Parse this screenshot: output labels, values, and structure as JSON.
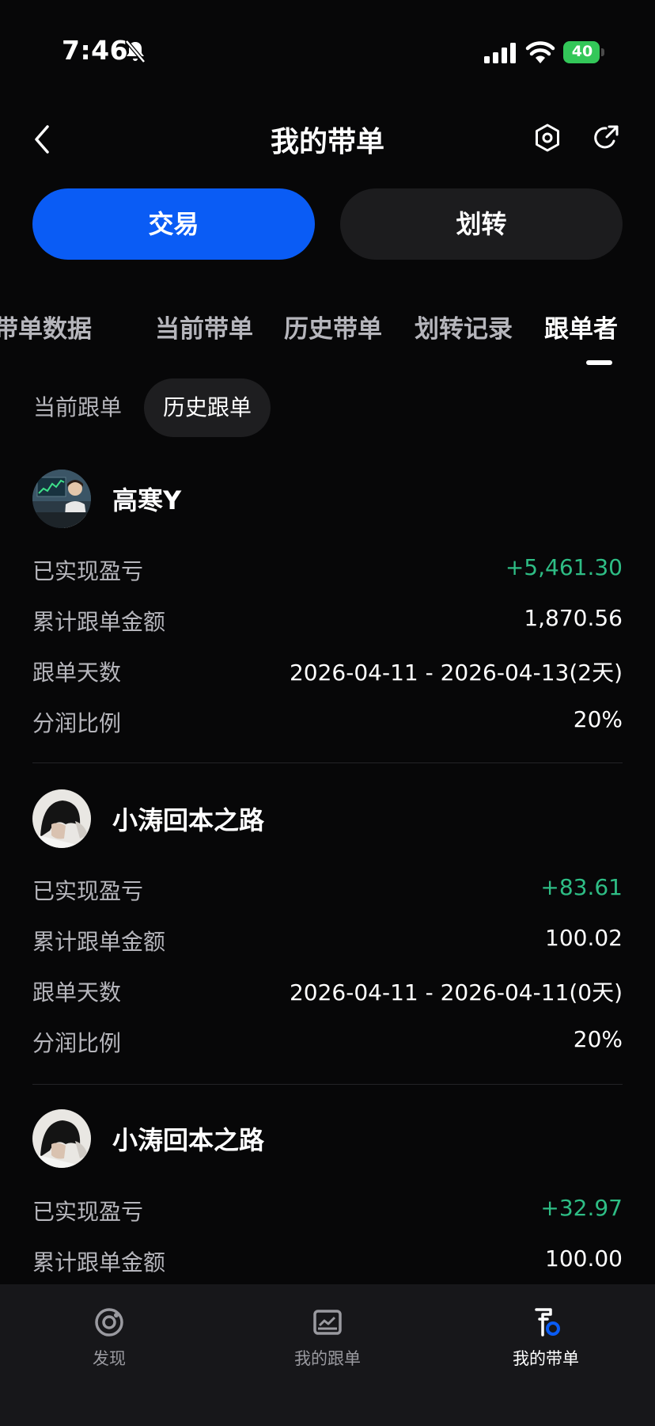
{
  "status_bar": {
    "time": "7:46",
    "battery": "40"
  },
  "header": {
    "title": "我的带单"
  },
  "actions": {
    "trade_label": "交易",
    "transfer_label": "划转"
  },
  "tabs": [
    {
      "label": "带单数据"
    },
    {
      "label": "当前带单"
    },
    {
      "label": "历史带单"
    },
    {
      "label": "划转记录"
    },
    {
      "label": "跟单者"
    }
  ],
  "subtabs": [
    {
      "label": "当前跟单"
    },
    {
      "label": "历史跟单"
    }
  ],
  "labels": {
    "realized_pnl": "已实现盈亏",
    "total_amount": "累计跟单金额",
    "days": "跟单天数",
    "profit_share": "分润比例"
  },
  "followers": [
    {
      "name": "高寒Y",
      "realized_pnl": "+5,461.30",
      "total_amount": "1,870.56",
      "days": "2026-04-11 - 2026-04-13(2天)",
      "profit_share": "20%"
    },
    {
      "name": "小涛回本之路",
      "realized_pnl": "+83.61",
      "total_amount": "100.02",
      "days": "2026-04-11 - 2026-04-11(0天)",
      "profit_share": "20%"
    },
    {
      "name": "小涛回本之路",
      "realized_pnl": "+32.97",
      "total_amount": "100.00"
    }
  ],
  "bottom_nav": [
    {
      "label": "发现",
      "icon": "discover-icon"
    },
    {
      "label": "我的跟单",
      "icon": "chart-icon"
    },
    {
      "label": "我的带单",
      "icon": "lead-trade-icon"
    }
  ],
  "colors": {
    "accent": "#0a5cf5",
    "positive": "#2ebd85",
    "background": "#070708"
  }
}
